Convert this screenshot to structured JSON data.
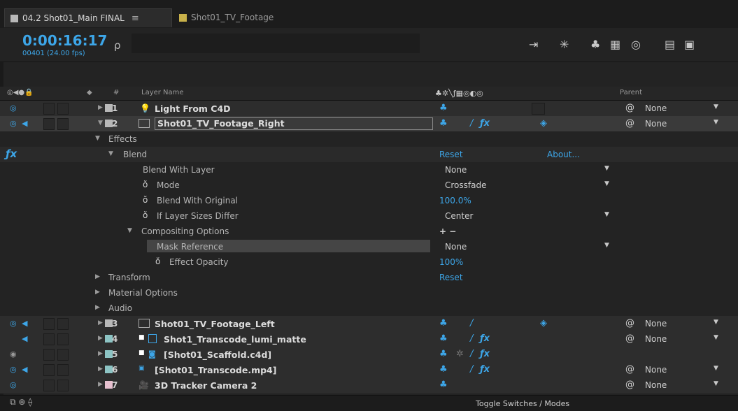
{
  "tabs": [
    {
      "label": "04.2 Shot01_Main FINAL",
      "menu": "≡",
      "color": "#b8b8b8"
    },
    {
      "label": "Shot01_TV_Footage",
      "color": "#c8b14a"
    }
  ],
  "timecode": "0:00:16:17",
  "frames_info": "00401 (24.00 fps)",
  "search_icon": "ρ",
  "header": {
    "num": "#",
    "layer_name": "Layer Name",
    "parent": "Parent"
  },
  "layers": [
    {
      "num": "1",
      "name": "Light From C4D",
      "icon": "light-icon",
      "color": "#b8b8b8",
      "parent": "None"
    },
    {
      "num": "2",
      "name": "Shot01_TV_Footage_Right",
      "icon": "footage-icon",
      "color": "#b8b8b8",
      "parent": "None"
    },
    {
      "num": "3",
      "name": "Shot01_TV_Footage_Left",
      "icon": "footage-icon",
      "color": "#b8b8b8",
      "parent": "None"
    },
    {
      "num": "4",
      "name": "Shot1_Transcode_lumi_matte",
      "icon": "comp-icon",
      "color": "#8dc4c4",
      "parent": "None"
    },
    {
      "num": "5",
      "name": "[Shot01_Scaffold.c4d]",
      "icon": "c4d-icon",
      "color": "#8dc4c4",
      "parent": ""
    },
    {
      "num": "6",
      "name": "[Shot01_Transcode.mp4]",
      "icon": "footage-icon",
      "color": "#8dc4c4",
      "parent": "None"
    },
    {
      "num": "7",
      "name": "3D Tracker Camera 2",
      "icon": "camera-icon",
      "color": "#e6c0cf",
      "parent": "None"
    }
  ],
  "props": {
    "effects": "Effects",
    "blend": "Blend",
    "reset": "Reset",
    "about": "About...",
    "blend_with_layer": "Blend With Layer",
    "blend_with_layer_val": "None",
    "mode": "Mode",
    "mode_val": "Crossfade",
    "blend_with_original": "Blend With Original",
    "blend_with_original_val": "100.0%",
    "if_layer_sizes_differ": "If Layer Sizes Differ",
    "if_layer_sizes_differ_val": "Center",
    "compositing_options": "Compositing Options",
    "compositing_val": "+ −",
    "mask_reference": "Mask Reference",
    "mask_reference_val": "None",
    "effect_opacity": "Effect Opacity",
    "effect_opacity_val": "100%",
    "transform": "Transform",
    "transform_reset": "Reset",
    "material_options": "Material Options",
    "audio": "Audio"
  },
  "bottom": {
    "toggle": "Toggle Switches / Modes"
  }
}
